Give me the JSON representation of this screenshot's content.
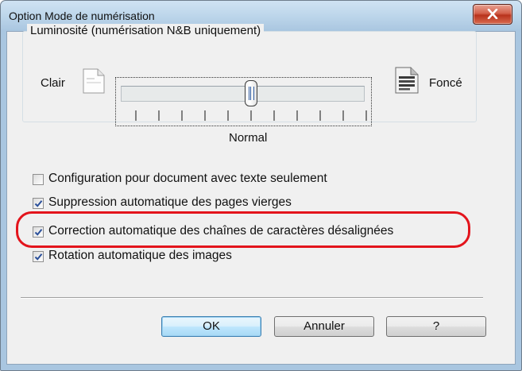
{
  "window": {
    "title": "Option Mode de numérisation",
    "close_symbol": "×"
  },
  "brightness": {
    "group_label": "Luminosité (numérisation N&B uniquement)",
    "min_label": "Clair",
    "max_label": "Foncé",
    "current_label": "Normal",
    "tick_count": 11,
    "position": 0.5,
    "light_icon": "light-page-icon",
    "dark_icon": "dark-page-icon"
  },
  "options": [
    {
      "label": "Configuration pour document avec texte seulement",
      "checked": false
    },
    {
      "label": "Suppression automatique des pages vierges",
      "checked": true
    },
    {
      "label": "Correction automatique des chaînes de caractères désalignées",
      "checked": true,
      "highlighted": true
    },
    {
      "label": "Rotation automatique des images",
      "checked": true
    }
  ],
  "buttons": {
    "ok": "OK",
    "cancel": "Annuler",
    "help": "?"
  },
  "colors": {
    "highlight": "#e3141c",
    "default_button_border": "#3c7fb1",
    "checkmark": "#2a4f9a"
  }
}
